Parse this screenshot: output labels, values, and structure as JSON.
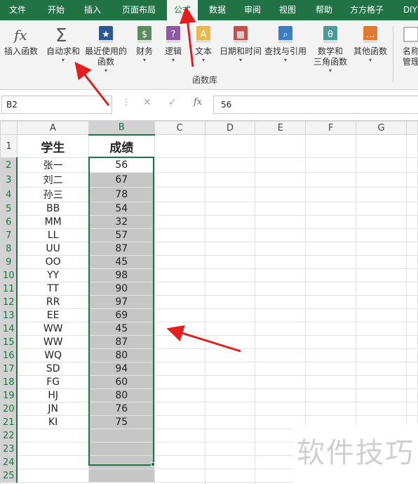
{
  "tabs": [
    {
      "label": "文件"
    },
    {
      "label": "开始"
    },
    {
      "label": "插入"
    },
    {
      "label": "页面布局"
    },
    {
      "label": "公式",
      "active": true
    },
    {
      "label": "数据"
    },
    {
      "label": "审阅"
    },
    {
      "label": "视图"
    },
    {
      "label": "帮助"
    },
    {
      "label": "方方格子"
    },
    {
      "label": "DIY"
    }
  ],
  "ribbon": {
    "group_label": "函数库",
    "buttons": [
      {
        "label": "插入函数",
        "icon": "fx-icon"
      },
      {
        "label": "自动求和",
        "icon": "sigma-icon",
        "dropdown": true
      },
      {
        "label": "最近使用的",
        "label2": "函数",
        "icon": "star-book-icon",
        "dropdown": true
      },
      {
        "label": "财务",
        "icon": "finance-book-icon",
        "dropdown": true
      },
      {
        "label": "逻辑",
        "icon": "question-book-icon",
        "dropdown": true
      },
      {
        "label": "文本",
        "icon": "text-book-icon",
        "dropdown": true
      },
      {
        "label": "日期和时间",
        "icon": "calendar-book-icon",
        "dropdown": true
      },
      {
        "label": "查找与引用",
        "icon": "search-book-icon",
        "dropdown": true
      },
      {
        "label": "数学和",
        "label2": "三角函数",
        "icon": "theta-book-icon",
        "dropdown": true
      },
      {
        "label": "其他函数",
        "icon": "more-book-icon",
        "dropdown": true
      },
      {
        "label": "名称",
        "label2": "管理",
        "icon": "name-manager-icon"
      }
    ]
  },
  "formula_bar": {
    "name_box": "B2",
    "formula": "56",
    "fx": "fx"
  },
  "columns": [
    "A",
    "B",
    "C",
    "D",
    "E",
    "F",
    "G"
  ],
  "selected_column": "B",
  "header_row": {
    "a": "学生",
    "b": "成绩"
  },
  "rows": [
    {
      "a": "张一",
      "b": "56"
    },
    {
      "a": "刘二",
      "b": "67"
    },
    {
      "a": "孙三",
      "b": "78"
    },
    {
      "a": "BB",
      "b": "54"
    },
    {
      "a": "MM",
      "b": "32"
    },
    {
      "a": "LL",
      "b": "57"
    },
    {
      "a": "UU",
      "b": "87"
    },
    {
      "a": "OO",
      "b": "45"
    },
    {
      "a": "YY",
      "b": "98"
    },
    {
      "a": "TT",
      "b": "90"
    },
    {
      "a": "RR",
      "b": "97"
    },
    {
      "a": "EE",
      "b": "69"
    },
    {
      "a": "WW",
      "b": "45"
    },
    {
      "a": "WW",
      "b": "87"
    },
    {
      "a": "WQ",
      "b": "80"
    },
    {
      "a": "SD",
      "b": "94"
    },
    {
      "a": "FG",
      "b": "60"
    },
    {
      "a": "HJ",
      "b": "80"
    },
    {
      "a": "JN",
      "b": "76"
    },
    {
      "a": "KI",
      "b": "75"
    },
    {
      "a": "",
      "b": ""
    },
    {
      "a": "",
      "b": ""
    },
    {
      "a": "",
      "b": ""
    },
    {
      "a": "",
      "b": ""
    }
  ],
  "row_numbers": [
    "1",
    "2",
    "3",
    "4",
    "5",
    "6",
    "7",
    "8",
    "9",
    "10",
    "11",
    "12",
    "13",
    "14",
    "15",
    "16",
    "17",
    "18",
    "19",
    "20",
    "21",
    "22",
    "23",
    "24",
    "25"
  ],
  "watermark": "软件技巧",
  "colors": {
    "accent": "#217346",
    "arrow": "#e02020",
    "selection": "#c6c6c6"
  }
}
